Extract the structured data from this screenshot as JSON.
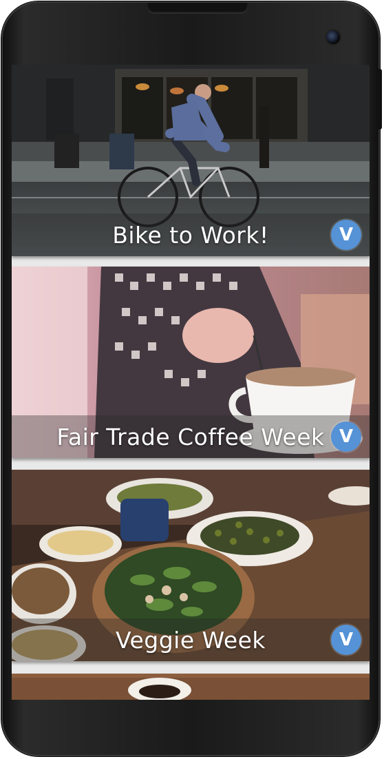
{
  "screen": {
    "cards": [
      {
        "title": "Bike to Work!",
        "badge_icon": "V"
      },
      {
        "title": "Fair Trade Coffee Week",
        "badge_icon": "V"
      },
      {
        "title": "Veggie Week",
        "badge_icon": "V"
      }
    ]
  },
  "colors": {
    "badge": "#5592d6",
    "phone_body": "#1a1a1a",
    "card_gap": "#e9e9e9"
  }
}
